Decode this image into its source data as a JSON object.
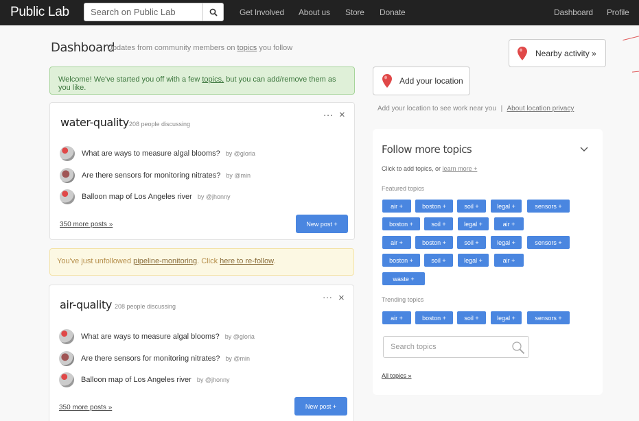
{
  "navbar": {
    "brand": "Public Lab",
    "search_placeholder": "Search on Public Lab",
    "links": [
      "Get Involved",
      "About us",
      "Store",
      "Donate"
    ],
    "right_links": [
      "Dashboard",
      "Profile"
    ]
  },
  "header": {
    "title": "Dashboard",
    "subtitle_pre": "Updates from community members on",
    "subtitle_link": "topics",
    "subtitle_post": "you follow",
    "nearby_button": "Nearby activity »",
    "add_location_button": "Add your location",
    "location_note": "Add your location to see work near you",
    "location_sep": "|",
    "location_privacy": "About location privacy"
  },
  "welcome": {
    "pre": "Welcome! We've started you off with a few",
    "link": "topics,",
    "post": "but you can add/remove them as you like."
  },
  "unfollow": {
    "pre": "You've just unfollowed",
    "topic": "pipeline-monitoring",
    "mid": ". Click",
    "link": "here to re-follow",
    "post": "."
  },
  "cards": [
    {
      "title": "water-quality",
      "count": "208 people discussing",
      "dots": "···",
      "close": "×",
      "posts": [
        {
          "title": "What are ways to measure algal blooms?",
          "by": "by @gloria"
        },
        {
          "title": "Are there sensors for monitoring nitrates?",
          "by": "by @min"
        },
        {
          "title": "Balloon map of Los Angeles river",
          "by": "by @jhonny"
        }
      ],
      "more": "350 more posts »",
      "new_post": "New post +"
    },
    {
      "title": "air-quality",
      "count": "208 people discussing",
      "dots": "···",
      "close": "×",
      "posts": [
        {
          "title": "What are ways to measure algal blooms?",
          "by": "by @gloria"
        },
        {
          "title": "Are there sensors for monitoring nitrates?",
          "by": "by @min"
        },
        {
          "title": "Balloon map of Los Angeles river",
          "by": "by @jhonny"
        }
      ],
      "more": "350 more posts »",
      "new_post": "New post +"
    }
  ],
  "follow": {
    "title": "Follow more topics",
    "sub_pre": "Click to add topics, or",
    "sub_link": "learn more +",
    "featured_label": "Featured  topics",
    "featured": [
      [
        "air +",
        "boston +",
        "soil +",
        "legal +",
        "sensors +"
      ],
      [
        "boston +",
        "soil +",
        "legal +",
        "air +"
      ],
      [
        "air +",
        "boston +",
        "soil +",
        "legal +",
        "sensors +"
      ],
      [
        "boston +",
        "soil +",
        "legal +",
        "air +"
      ],
      [
        "waste +"
      ]
    ],
    "trending_label": "Trending topics",
    "trending": [
      "air +",
      "boston +",
      "soil +",
      "legal +",
      "sensors +"
    ],
    "search_placeholder": "Search topics",
    "all_topics": "All topics »"
  },
  "colors": {
    "navbar": "#222222",
    "tag": "#4a86e0",
    "success_bg": "#dff0d8",
    "warning_bg": "#fcf8e3",
    "marker": "#e04848"
  }
}
